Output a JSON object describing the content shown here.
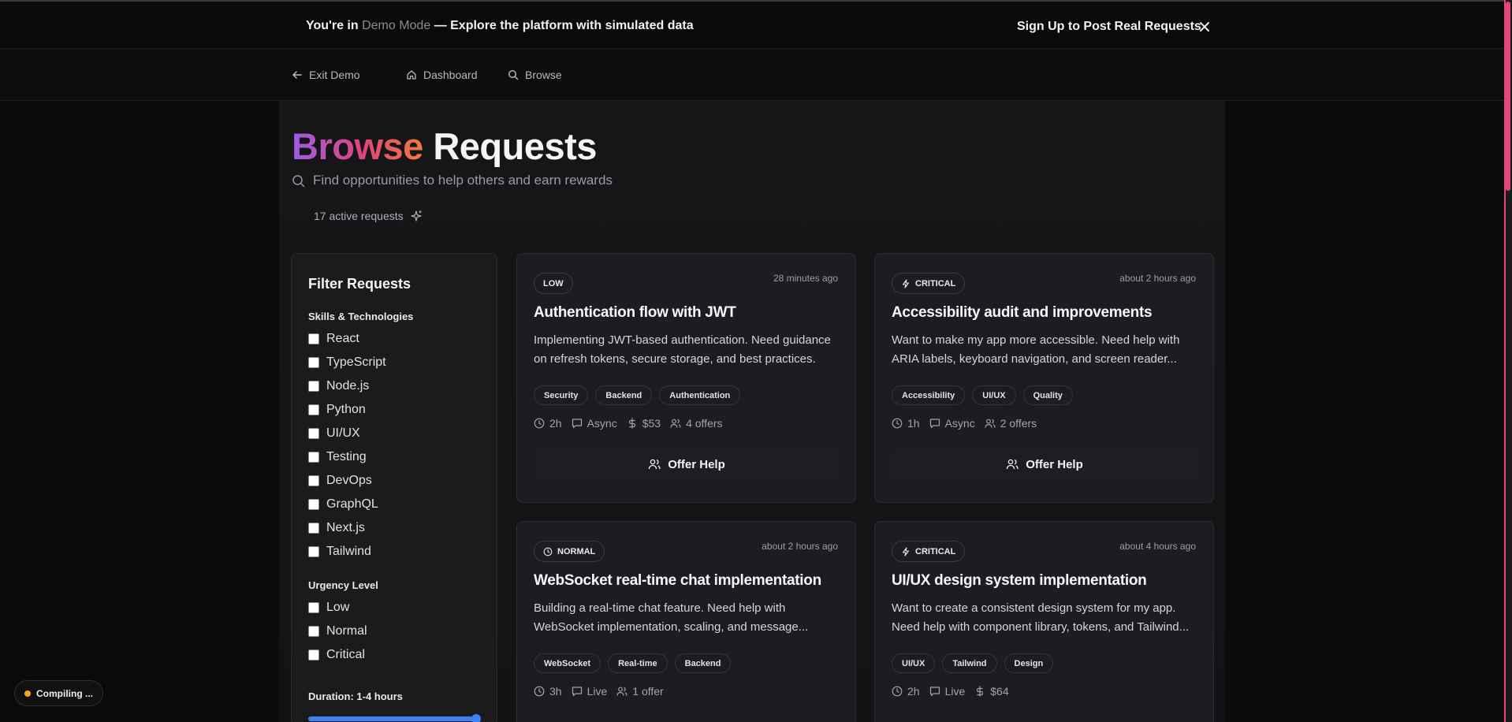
{
  "banner": {
    "prefix": "You're in",
    "demo_mode": "Demo Mode",
    "suffix": "— Explore the platform with simulated data",
    "signup": "Sign Up to Post Real Requests"
  },
  "nav": {
    "exit": "Exit Demo",
    "dashboard": "Dashboard",
    "browse": "Browse"
  },
  "page": {
    "title_accent": "Browse",
    "title_rest": "Requests",
    "subtitle": "Find opportunities to help others and earn rewards",
    "active_count": "17 active requests"
  },
  "filters": {
    "title": "Filter Requests",
    "skills_label": "Skills & Technologies",
    "skills": [
      "React",
      "TypeScript",
      "Node.js",
      "Python",
      "UI/UX",
      "Testing",
      "DevOps",
      "GraphQL",
      "Next.js",
      "Tailwind"
    ],
    "urgency_label": "Urgency Level",
    "urgency": [
      "Low",
      "Normal",
      "Critical"
    ],
    "duration_label": "Duration: 1-4 hours"
  },
  "cards": [
    {
      "urgency": "LOW",
      "time": "28 minutes ago",
      "title": "Authentication flow with JWT",
      "desc": "Implementing JWT-based authentication. Need guidance on refresh tokens, secure storage, and best practices.",
      "tags": [
        "Security",
        "Backend",
        "Authentication"
      ],
      "duration": "2h",
      "mode": "Async",
      "price": "$53",
      "offers": "4 offers",
      "cta": "Offer Help"
    },
    {
      "urgency": "CRITICAL",
      "time": "about 2 hours ago",
      "title": "Accessibility audit and improvements",
      "desc": "Want to make my app more accessible. Need help with ARIA labels, keyboard navigation, and screen reader...",
      "tags": [
        "Accessibility",
        "UI/UX",
        "Quality"
      ],
      "duration": "1h",
      "mode": "Async",
      "offers": "2 offers",
      "cta": "Offer Help"
    },
    {
      "urgency": "NORMAL",
      "time": "about 2 hours ago",
      "title": "WebSocket real-time chat implementation",
      "desc": "Building a real-time chat feature. Need help with WebSocket implementation, scaling, and message...",
      "tags": [
        "WebSocket",
        "Real-time",
        "Backend"
      ],
      "duration": "3h",
      "mode": "Live",
      "offers": "1 offer"
    },
    {
      "urgency": "CRITICAL",
      "time": "about 4 hours ago",
      "title": "UI/UX design system implementation",
      "desc": "Want to create a consistent design system for my app. Need help with component library, tokens, and Tailwind...",
      "tags": [
        "UI/UX",
        "Tailwind",
        "Design"
      ],
      "duration": "2h",
      "mode": "Live",
      "price": "$64"
    }
  ],
  "status": {
    "compiling": "Compiling ..."
  },
  "colors": {
    "accent_pink": "#e0457b",
    "accent_purple": "#9b5de5",
    "accent_orange": "#f07a3a",
    "slider_blue": "#3b82f6"
  }
}
